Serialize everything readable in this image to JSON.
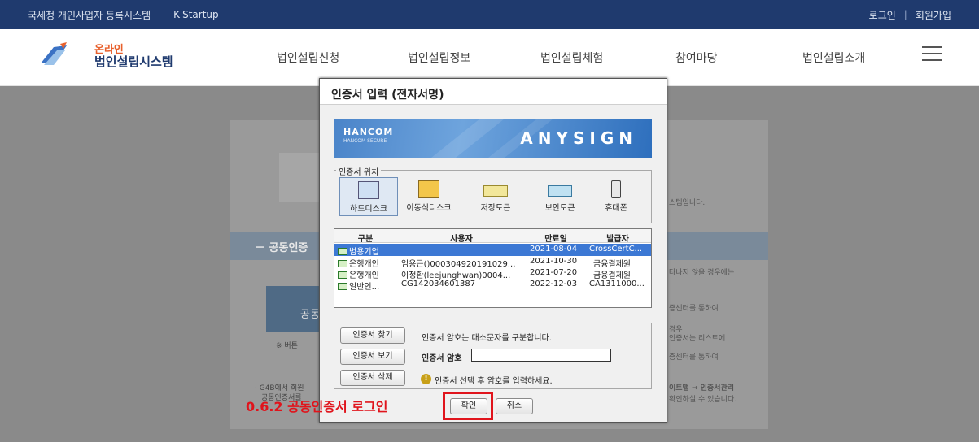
{
  "topbar": {
    "links": [
      "국세청 개인사업자 등록시스템",
      "K-Startup"
    ],
    "login": "로그인",
    "sep": "|",
    "signup": "회원가입"
  },
  "logo": {
    "line1": "온라인",
    "line2": "법인설립시스템"
  },
  "nav": [
    "법인설립신청",
    "법인설립정보",
    "법인설립체험",
    "참여마당",
    "법인설립소개"
  ],
  "background": {
    "strip_label": "－ 공동인증",
    "button_text": "공동",
    "note_small": "※ 버튼",
    "note_bottom1": "· G4B에서 회원",
    "note_bottom2": "공동인증서를",
    "right_texts": [
      "스템입니다.",
      "타나지 않을 경우에는",
      "증센터를 통하여",
      "경우",
      "인증서는 리스트에",
      "증센터를 통하여",
      "이트맵 → 인증서관리",
      "확인하실 수 있습니다."
    ]
  },
  "dialog": {
    "title": "인증서 입력 (전자서명)",
    "banner": {
      "brand": "HANCOM",
      "brand_sub": "HANCOM SECURE",
      "product": "ANYSIGN"
    },
    "location_group_label": "인증서 위치",
    "locations": [
      {
        "label": "하드디스크",
        "icon": "hard-disk-icon",
        "selected": true
      },
      {
        "label": "이동식디스크",
        "icon": "removable-disk-icon",
        "selected": false
      },
      {
        "label": "저장토큰",
        "icon": "storage-token-icon",
        "selected": false
      },
      {
        "label": "보안토큰",
        "icon": "security-token-icon",
        "selected": false
      },
      {
        "label": "휴대폰",
        "icon": "mobile-phone-icon",
        "selected": false
      }
    ],
    "table": {
      "headers": [
        "구분",
        "사용자",
        "만료일",
        "발급자"
      ],
      "rows": [
        {
          "type": "범용기업",
          "user": "",
          "expiry": "2021-08-04",
          "issuer": "CrossCertC...",
          "selected": true
        },
        {
          "type": "은행개인",
          "user": "임용근()000304920191029...",
          "expiry": "2021-10-30",
          "issuer": "금융결제원",
          "selected": false
        },
        {
          "type": "은행개인",
          "user": "이정환(leejunghwan)0004...",
          "expiry": "2021-07-20",
          "issuer": "금융결제원",
          "selected": false
        },
        {
          "type": "일반인...",
          "user": "CG142034601387",
          "expiry": "2022-12-03",
          "issuer": "CA1311000...",
          "selected": false
        }
      ]
    },
    "find_button": "인증서 찾기",
    "find_hint": "인증서 암호는 대소문자를 구분합니다.",
    "view_button": "인증서 보기",
    "password_label": "인증서 암호",
    "password_value": "",
    "delete_button": "인증서 삭제",
    "delete_hint": "인증서 선택 후 암호를 입력하세요.",
    "ok_button": "확인",
    "cancel_button": "취소"
  },
  "annotation": {
    "caption": "0.6.2 공동인증서 로그인",
    "color": "#e0141c"
  }
}
